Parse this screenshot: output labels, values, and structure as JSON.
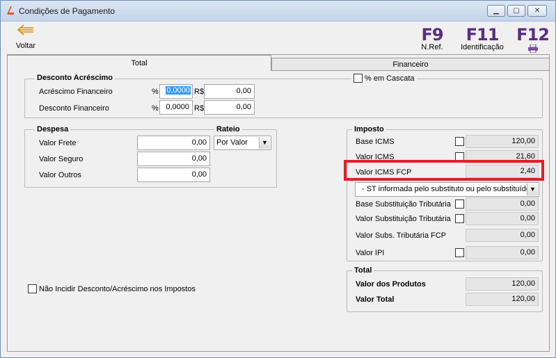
{
  "window": {
    "title": "Condições de Pagamento"
  },
  "toolbar": {
    "back_label": "Voltar",
    "f9_key": "F9",
    "f9_label": "N.Ref.",
    "f11_key": "F11",
    "f11_label": "Identificação",
    "f12_key": "F12"
  },
  "tabs": [
    {
      "label": "Total"
    },
    {
      "label": "Financeiro"
    }
  ],
  "desconto": {
    "title": "Desconto Acréscimo",
    "cascata_label": "% em Cascata",
    "acrescimo_label": "Acréscimo Financeiro",
    "acrescimo_pct": "0,0000",
    "acrescimo_rs": "0,00",
    "desconto_label": "Desconto Financeiro",
    "desconto_pct": "0,0000",
    "desconto_rs": "0,00",
    "pct_symbol": "%",
    "rs_symbol": "R$"
  },
  "despesa": {
    "title": "Despesa",
    "rateio_title": "Rateio",
    "frete_label": "Valor Frete",
    "frete_value": "0,00",
    "seguro_label": "Valor Seguro",
    "seguro_value": "0,00",
    "outros_label": "Valor Outros",
    "outros_value": "0,00",
    "rateio_value": "Por Valor"
  },
  "nao_incidir_label": "Não Incidir Desconto/Acréscimo nos Impostos",
  "imposto": {
    "title": "Imposto",
    "base_icms_label": "Base ICMS",
    "base_icms_value": "120,00",
    "valor_icms_label": "Valor ICMS",
    "valor_icms_value": "21,60",
    "valor_icms_fcp_label": "Valor ICMS FCP",
    "valor_icms_fcp_value": "2,40",
    "st_select": "- ST informada pelo substituto ou pelo substituído",
    "base_st_label": "Base Substituição Tributária",
    "base_st_value": "0,00",
    "valor_st_label": "Valor Substituição Tributária",
    "valor_st_value": "0,00",
    "valor_st_fcp_label": "Valor Subs. Tributária FCP",
    "valor_st_fcp_value": "0,00",
    "valor_ipi_label": "Valor IPI",
    "valor_ipi_value": "0,00"
  },
  "total": {
    "title": "Total",
    "produtos_label": "Valor dos Produtos",
    "produtos_value": "120,00",
    "total_label": "Valor Total",
    "total_value": "120,00"
  },
  "colors": {
    "highlight": "#e0202a",
    "fkey": "#5a2d82",
    "back_arrow": "#e08a00"
  }
}
